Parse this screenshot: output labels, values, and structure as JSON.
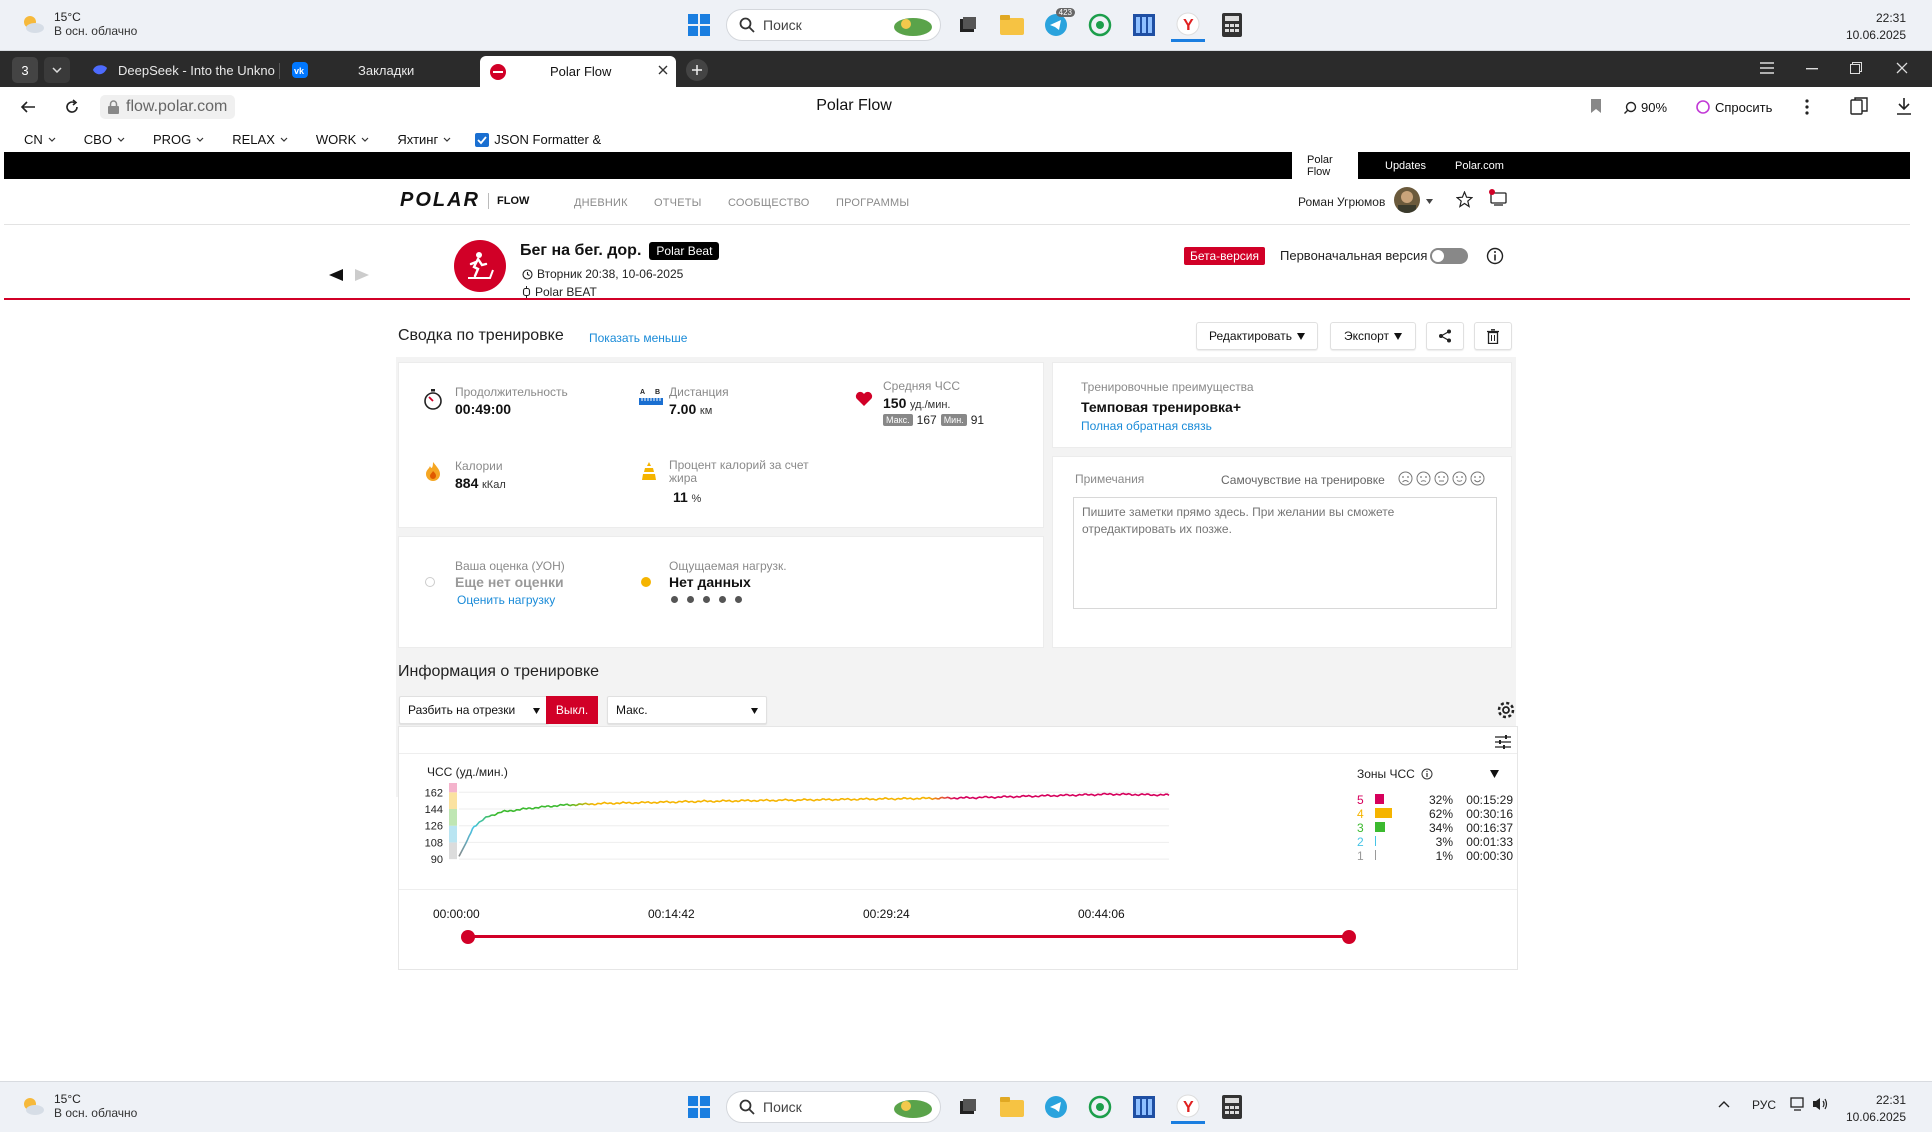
{
  "taskbar_top": {
    "weather_temp": "15°C",
    "weather_desc": "В осн. облачно",
    "search_placeholder": "Поиск",
    "telegram_badge": "423",
    "time": "22:31",
    "date": "10.06.2025"
  },
  "tabs": {
    "count": "3",
    "items": [
      {
        "label": "DeepSeek - Into the Unkno"
      },
      {
        "label": "Закладки"
      },
      {
        "label": "Polar Flow"
      }
    ]
  },
  "address": {
    "url": "flow.polar.com",
    "title": "Polar Flow",
    "zoom": "90%",
    "ask": "Спросить"
  },
  "bookmarks": [
    {
      "label": "CN"
    },
    {
      "label": "CBO"
    },
    {
      "label": "PROG"
    },
    {
      "label": "RELAX"
    },
    {
      "label": "WORK"
    },
    {
      "label": "Яхтинг"
    },
    {
      "label": "JSON Formatter &"
    }
  ],
  "topbar": {
    "tabs": [
      "Polar Flow",
      "Updates",
      "Polar.com"
    ]
  },
  "nav": {
    "brand": "POLAR",
    "brand_sub": "FLOW",
    "links": [
      "ДНЕВНИК",
      "ОТЧЕТЫ",
      "СООБЩЕСТВО",
      "ПРОГРАММЫ"
    ],
    "user": "Роман Угрюмов"
  },
  "session": {
    "title": "Бег на бег. дор.",
    "device_badge": "Polar Beat",
    "datetime": "Вторник 20:38, 10-06-2025",
    "device": "Polar BEAT",
    "beta_badge": "Бета-версия",
    "original_label": "Первоначальная версия"
  },
  "summary": {
    "heading": "Сводка по тренировке",
    "toggle_link": "Показать меньше",
    "edit_btn": "Редактировать",
    "export_btn": "Экспорт",
    "duration_label": "Продолжительность",
    "duration": "00:49:00",
    "distance_label": "Дистанция",
    "distance": "7.00",
    "distance_unit": "км",
    "hr_label": "Средняя ЧСС",
    "hr_avg": "150",
    "hr_unit": "уд./мин.",
    "hr_max_tag": "Макс.",
    "hr_max": "167",
    "hr_min_tag": "Мин.",
    "hr_min": "91",
    "calories_label": "Калории",
    "calories": "884",
    "calories_unit": "кКал",
    "fat_label": "Процент калорий за счет жира",
    "fat": "11",
    "fat_unit": "%",
    "rpe_label": "Ваша оценка (УОН)",
    "rpe_value": "Еще нет оценки",
    "rpe_link": "Оценить нагрузку",
    "load_label": "Ощущаемая нагрузк.",
    "load_value": "Нет данных",
    "benefit_label": "Тренировочные преимущества",
    "benefit": "Темповая тренировка+",
    "benefit_link": "Полная обратная связь",
    "notes_label": "Примечания",
    "feeling_label": "Самочувствие на тренировке",
    "notes_placeholder": "Пишите заметки прямо здесь. При желании вы сможете отредактировать их позже."
  },
  "info": {
    "heading": "Информация о тренировке",
    "split_select": "Разбить на отрезки",
    "split_state": "Выкл.",
    "metric_select": "Макс."
  },
  "chart_data": {
    "type": "line",
    "ylabel": "ЧСС (уд./мин.)",
    "yticks": [
      90,
      108,
      126,
      144,
      162
    ],
    "ylim": [
      88,
      172
    ],
    "xlim_seconds": [
      0,
      2940
    ],
    "x_ticks": [
      "00:00:00",
      "00:14:42",
      "00:29:24",
      "00:44:06"
    ],
    "series": [
      {
        "x": [
          0,
          30,
          60,
          120,
          180,
          300,
          420,
          600,
          780,
          960,
          1200,
          1500,
          1800,
          2100,
          2400,
          2700,
          2940
        ],
        "values": [
          93,
          108,
          125,
          136,
          141,
          145,
          148,
          150,
          151,
          152,
          153,
          154,
          155,
          156,
          158,
          160,
          159
        ]
      }
    ],
    "zones_title": "Зоны ЧСС",
    "zones": [
      {
        "zone": "5",
        "percent": "32%",
        "time": "00:15:29",
        "color": "#d6005c",
        "share": 0.32
      },
      {
        "zone": "4",
        "percent": "62%",
        "time": "00:30:16",
        "color": "#f5b400",
        "share": 0.62
      },
      {
        "zone": "3",
        "percent": "34%",
        "time": "00:16:37",
        "color": "#3cba2f",
        "share": 0.34
      },
      {
        "zone": "2",
        "percent": "3%",
        "time": "00:01:33",
        "color": "#46c4e6",
        "share": 0.03
      },
      {
        "zone": "1",
        "percent": "1%",
        "time": "00:00:30",
        "color": "#9a9a9a",
        "share": 0.01
      }
    ]
  },
  "taskbar_bottom": {
    "weather_temp": "15°C",
    "weather_desc": "В осн. облачно",
    "search_placeholder": "Поиск",
    "lang": "РУС",
    "time": "22:31",
    "date": "10.06.2025"
  },
  "colors": {
    "polar_red": "#d10027",
    "link": "#1a8bd8"
  }
}
